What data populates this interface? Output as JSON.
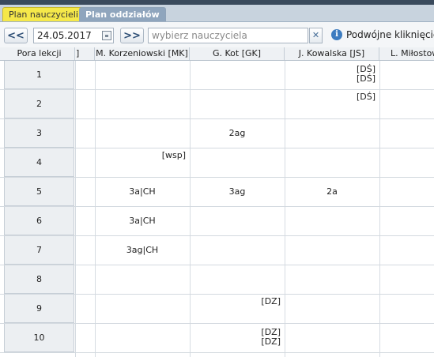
{
  "tabs": [
    {
      "label": "Plan nauczycieli"
    },
    {
      "label": "Plan oddziałów"
    }
  ],
  "toolbar": {
    "prev_label": "<<",
    "date_value": "24.05.2017",
    "next_label": ">>",
    "teacher_placeholder": "wybierz nauczyciela",
    "clear_label": "✕",
    "info_label": "i",
    "hint_text": "Podwójne kliknięcie"
  },
  "table": {
    "headers": [
      "Pora lekcji",
      "]",
      "M. Korzeniowski [MK]",
      "G. Kot [GK]",
      "J. Kowalska [JS]",
      "L. Miłostowski"
    ],
    "rows": [
      {
        "lesson": "1",
        "cells": [
          "",
          "",
          "",
          "[DŚ]\n[DŚ]",
          ""
        ]
      },
      {
        "lesson": "2",
        "cells": [
          "",
          "",
          "",
          "[DŚ]",
          ""
        ]
      },
      {
        "lesson": "3",
        "cells": [
          "",
          "",
          "2ag",
          "",
          ""
        ]
      },
      {
        "lesson": "4",
        "cells": [
          "",
          "[wsp]",
          "",
          "",
          ""
        ]
      },
      {
        "lesson": "5",
        "cells": [
          "",
          "3a|CH",
          "3ag",
          "2a",
          ""
        ]
      },
      {
        "lesson": "6",
        "cells": [
          "",
          "3a|CH",
          "",
          "",
          ""
        ]
      },
      {
        "lesson": "7",
        "cells": [
          "",
          "3ag|CH",
          "",
          "",
          ""
        ]
      },
      {
        "lesson": "8",
        "cells": [
          "",
          "",
          "",
          "",
          ""
        ]
      },
      {
        "lesson": "9",
        "cells": [
          "",
          "",
          "[DZ]",
          "",
          ""
        ]
      },
      {
        "lesson": "10",
        "cells": [
          "",
          "",
          "[DZ]\n[DZ]",
          "",
          ""
        ]
      }
    ]
  }
}
